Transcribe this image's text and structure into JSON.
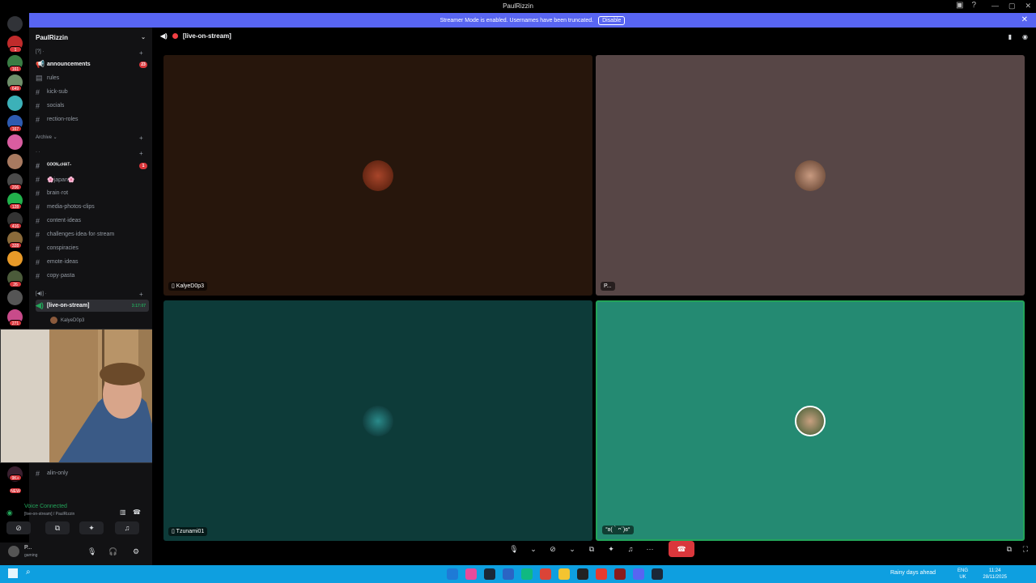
{
  "window": {
    "title": "PaulRizzin"
  },
  "banner": {
    "text": "Streamer Mode is enabled. Usernames have been truncated.",
    "disable_label": "Disable"
  },
  "server": {
    "name": "PaulRizzin"
  },
  "rail_badges": [
    "1",
    "161",
    "649",
    "167",
    "1",
    "9",
    "206",
    "128",
    "416",
    "328",
    "1",
    "26",
    "271",
    "9K+",
    "NEW",
    "202"
  ],
  "categories": {
    "top": "[?] ·",
    "archive": "Archive",
    "cat2": "· ·",
    "voice": "[◀)] ·"
  },
  "channels": [
    {
      "name": "announcements",
      "count": "23"
    },
    {
      "name": "rules"
    },
    {
      "name": "kick-sub"
    },
    {
      "name": "socials"
    },
    {
      "name": "rection-roles"
    },
    {
      "name": "ᴳᴼᴼᴺ-ᶜᴴᴬᵀ·",
      "count": "1"
    },
    {
      "name": "🌸japan🌸"
    },
    {
      "name": "brain·rot"
    },
    {
      "name": "media-photos-clips"
    },
    {
      "name": "content·ideas"
    },
    {
      "name": "challenges·idea·for·stream"
    },
    {
      "name": "conspiracies"
    },
    {
      "name": "emote·ideas"
    },
    {
      "name": "copy·pasta"
    },
    {
      "name": "alin-only"
    }
  ],
  "voice_channel": {
    "name": "[live-on-stream]",
    "timer": "3:17:07",
    "user": "KalyeD0p3"
  },
  "main": {
    "channel": "[live-on-stream]"
  },
  "participants": [
    {
      "name": "KalyeD0p3"
    },
    {
      "name": "P..."
    },
    {
      "name": "Tzunami01"
    },
    {
      "name": "°ʚ(｀ᴖ´)ɞ°"
    }
  ],
  "voice_connected": {
    "status": "Voice Connected",
    "detail": "[live-on-stream] / PaulRizzin"
  },
  "user": {
    "name": "P...",
    "status": "gaming"
  },
  "taskbar": {
    "weather": "Rainy days ahead",
    "lang1": "ENG",
    "lang2": "UK",
    "time": "11:24",
    "date": "28/11/2025"
  },
  "colors": {
    "blurple": "#5865f2",
    "tile1": "#27160c",
    "tile2": "#574646",
    "tile3": "#0d3b39",
    "tile4": "#248a72",
    "taskbar": "#0e9fe0"
  }
}
